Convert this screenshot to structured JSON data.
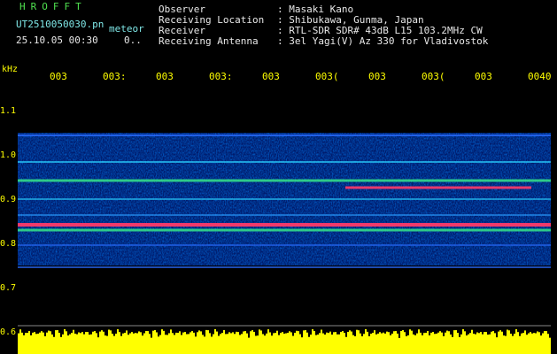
{
  "header": {
    "station": "HROFFT",
    "filename": "UT2510050030.pn",
    "mode": "meteor",
    "datetime": "25.10.05 00:30",
    "count": "0..",
    "fields": [
      {
        "label": "Observer",
        "value": ": Masaki Kano"
      },
      {
        "label": "Receiving Location",
        "value": ": Shibukawa, Gunma, Japan"
      },
      {
        "label": "Receiver",
        "value": ": RTL-SDR SDR# 43dB L15 103.2MHz CW"
      },
      {
        "label": "Receiving Antenna",
        "value": ": 3el Yagi(V) Az 330 for Vladivostok"
      }
    ]
  },
  "axis": {
    "unit": "kHz",
    "y_ticks": [
      "1.1",
      "1.0",
      "0.9",
      "0.8",
      "0.7",
      "0.6"
    ],
    "x_ticks": [
      "003",
      "003:",
      "003",
      "003:",
      "003",
      "003(",
      "003",
      "003(",
      "003",
      "0040"
    ]
  },
  "colors": {
    "background": "#000000",
    "label_cyan": "#7fe7e7",
    "label_green": "#4fe04f",
    "axis_yellow": "#ffff00",
    "signal_red": "#ff3a6a"
  }
}
